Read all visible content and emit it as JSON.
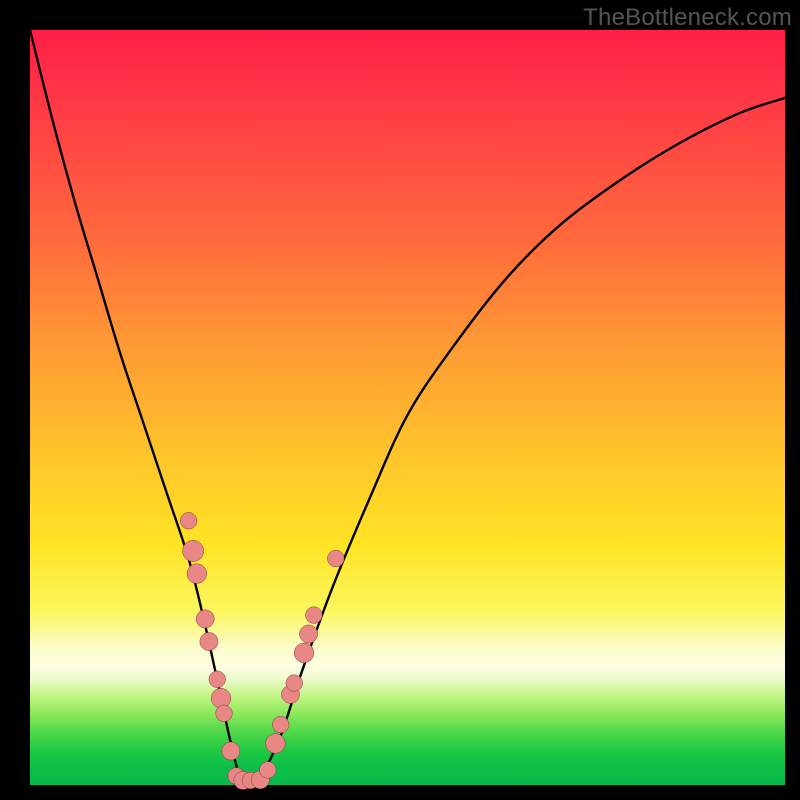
{
  "watermark": "TheBottleneck.com",
  "colors": {
    "frame": "#000000",
    "curve": "#000000",
    "marker_fill": "#e98686",
    "marker_stroke": "#7a3a3a"
  },
  "chart_data": {
    "type": "line",
    "title": "",
    "xlabel": "",
    "ylabel": "",
    "xlim": [
      0,
      100
    ],
    "ylim": [
      0,
      100
    ],
    "grid": false,
    "legend": false,
    "note": "V-shaped bottleneck curve. Axes are unlabeled; values are estimated proportions of the plot area (0=left/bottom, 100=right/top). y≈0 is the optimal (green) zone; higher y = worse (red).",
    "series": [
      {
        "name": "bottleneck-curve",
        "x": [
          0,
          3,
          6,
          9,
          12,
          15,
          18,
          21,
          23,
          25,
          26.5,
          28,
          30,
          33,
          36,
          40,
          45,
          50,
          56,
          63,
          70,
          78,
          86,
          94,
          100
        ],
        "y": [
          100,
          88,
          77,
          67,
          57,
          48,
          39,
          30,
          22,
          13,
          6,
          0.8,
          0.5,
          6,
          15,
          26,
          38,
          49,
          58,
          67,
          74,
          80,
          85,
          89,
          91
        ]
      }
    ],
    "markers": {
      "name": "highlighted-points",
      "note": "Salmon circular markers clustered near the curve minimum on both branches.",
      "points": [
        {
          "x": 21.0,
          "y": 35.0,
          "r": 1.1
        },
        {
          "x": 21.6,
          "y": 31.0,
          "r": 1.4
        },
        {
          "x": 22.1,
          "y": 28.0,
          "r": 1.3
        },
        {
          "x": 23.2,
          "y": 22.0,
          "r": 1.2
        },
        {
          "x": 23.7,
          "y": 19.0,
          "r": 1.2
        },
        {
          "x": 24.8,
          "y": 14.0,
          "r": 1.1
        },
        {
          "x": 25.3,
          "y": 11.5,
          "r": 1.3
        },
        {
          "x": 25.7,
          "y": 9.5,
          "r": 1.1
        },
        {
          "x": 26.6,
          "y": 4.5,
          "r": 1.2
        },
        {
          "x": 27.3,
          "y": 1.2,
          "r": 1.1
        },
        {
          "x": 28.2,
          "y": 0.6,
          "r": 1.2
        },
        {
          "x": 29.2,
          "y": 0.6,
          "r": 1.1
        },
        {
          "x": 30.5,
          "y": 0.7,
          "r": 1.2
        },
        {
          "x": 31.5,
          "y": 2.0,
          "r": 1.1
        },
        {
          "x": 32.5,
          "y": 5.5,
          "r": 1.3
        },
        {
          "x": 33.2,
          "y": 8.0,
          "r": 1.1
        },
        {
          "x": 34.5,
          "y": 12.0,
          "r": 1.2
        },
        {
          "x": 35.0,
          "y": 13.5,
          "r": 1.1
        },
        {
          "x": 36.3,
          "y": 17.5,
          "r": 1.3
        },
        {
          "x": 36.9,
          "y": 20.0,
          "r": 1.2
        },
        {
          "x": 37.6,
          "y": 22.5,
          "r": 1.1
        },
        {
          "x": 40.5,
          "y": 30.0,
          "r": 1.1
        }
      ]
    }
  }
}
